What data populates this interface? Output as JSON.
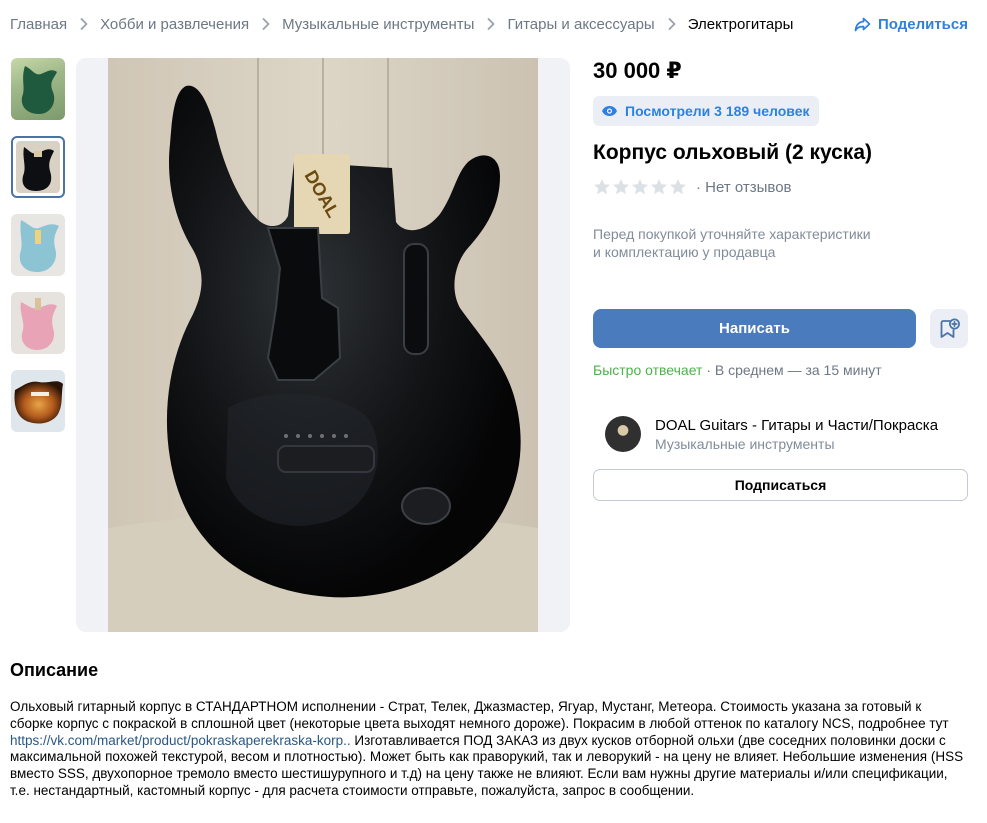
{
  "breadcrumb": {
    "items": [
      "Главная",
      "Хобби и развлечения",
      "Музыкальные инструменты",
      "Гитары и аксессуары",
      "Электрогитары"
    ],
    "share_label": "Поделиться"
  },
  "product": {
    "price": "30 000 ₽",
    "views": "Посмотрели 3 189 человек",
    "title": "Корпус ольховый (2 куска)",
    "rating_stars": 0,
    "reviews": "· Нет отзывов",
    "note_line1": "Перед покупкой уточняйте характеристики",
    "note_line2": "и комплектацию у продавца",
    "write_button": "Написать",
    "response_fast": "Быстро отвечает",
    "response_avg": " · В среднем — за 15 минут"
  },
  "seller": {
    "name": "DOAL Guitars - Гитары и Части/Покраска",
    "category": "Музыкальные инструменты",
    "subscribe": "Подписаться"
  },
  "description": {
    "title": "Описание",
    "text_before_link": "Ольховый гитарный корпус в СТАНДАРТНОМ исполнении - Страт, Телек, Джазмастер, Ягуар, Мустанг, Метеора. Стоимость указана за готовый к сборке корпус с покраской в сплошной цвет (некоторые цвета выходят немного дороже). Покрасим в любой оттенок по каталогу NCS, подробнее тут ",
    "link": "https://vk.com/market/product/pokraskaperekraska-korp..",
    "text_after_link": " Изготавливается ПОД ЗАКАЗ из двух кусков отборной ольхи (две соседних половинки доски с максимальной похожей текстурой, весом и плотностью). Может быть как праворукий, так и леворукий - на цену не влияет. Небольшие изменения (HSS вместо SSS, двухопорное тремоло вместо шестишурупного и т.д) на цену также не влияют. Если вам нужны другие материалы и/или спецификации, т.е. нестандартный, кастомный корпус - для расчета стоимости отправьте, пожалуйста, запрос в сообщении."
  },
  "colors": {
    "accent": "#2d81e0",
    "button": "#4a7bbc",
    "positive": "#4bb34b",
    "secondary_text": "#6d7885"
  },
  "icons": [
    "chevron-right-icon",
    "share-icon",
    "eye-icon",
    "star-icon",
    "bookmark-add-icon"
  ]
}
